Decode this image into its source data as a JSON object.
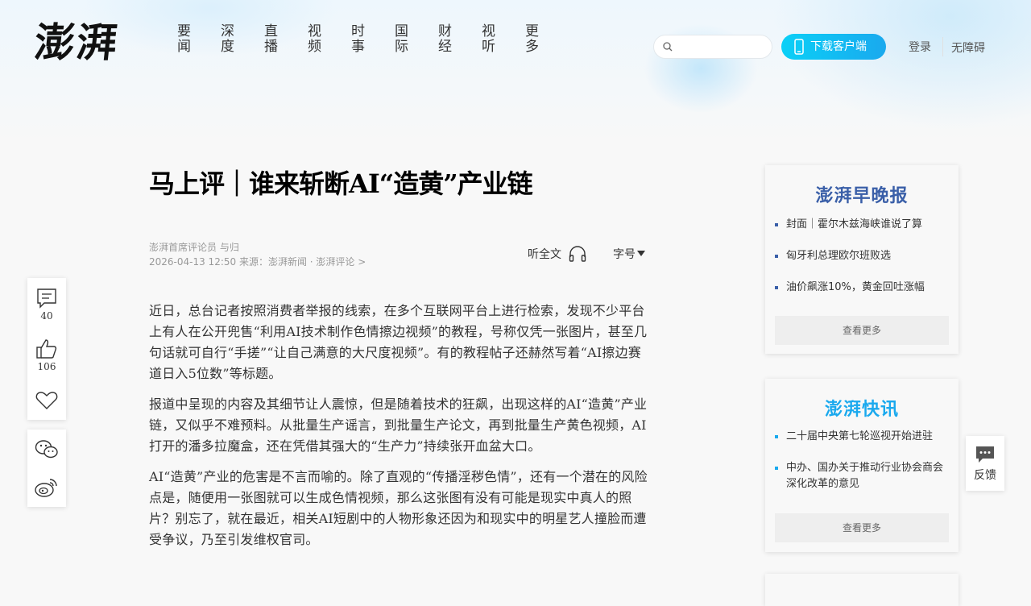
{
  "header": {
    "logo": "澎湃",
    "nav": [
      "要闻",
      "深度",
      "直播",
      "视频",
      "时事",
      "国际",
      "财经",
      "视听",
      "更多"
    ],
    "search_placeholder": "",
    "download_label": "下载客户端",
    "login_label": "登录",
    "accessibility_label": "无障碍"
  },
  "article": {
    "title": "马上评｜谁来斩断AI“造黄”产业链",
    "author": "澎湃首席评论员 与归",
    "meta": "2026-04-13 12:50  来源：澎湃新闻 · 澎湃评论 >",
    "listen_label": "听全文",
    "font_size_label": "字号",
    "paragraphs": [
      "近日，总台记者按照消费者举报的线索，在多个互联网平台上进行检索，发现不少平台上有人在公开兜售“利用AI技术制作色情擦边视频”的教程，号称仅凭一张图片，甚至几句话就可自行“手搓”“让自己满意的大尺度视频”。有的教程帖子还赫然写着“AI擦边赛道日入5位数”等标题。",
      "报道中呈现的内容及其细节让人震惊，但是随着技术的狂飙，出现这样的AI“造黄”产业链，又似乎不难预料。从批量生产谣言，到批量生产论文，再到批量生产黄色视频，AI打开的潘多拉魔盒，还在凭借其强大的“生产力”持续张开血盆大口。",
      "AI“造黄”产业的危害是不言而喻的。除了直观的“传播淫秽色情”，还有一个潜在的风险点是，随便用一张图就可以生成色情视频，那么这张图有没有可能是现实中真人的照片？别忘了，就在最近，相关AI短剧中的人物形象还因为和现实中的明星艺人撞脸而遭受争议，乃至引发维权官司。"
    ]
  },
  "toolbar": {
    "comment_count": "40",
    "like_count": "106"
  },
  "sidebar": {
    "evening_logo": "澎湃早晚报",
    "evening_items": [
      "封面｜霍尔木兹海峡谁说了算",
      "匈牙利总理欧尔班败选",
      "油价飙涨10%，黄金回吐涨幅"
    ],
    "evening_more": "查看更多",
    "express_logo": "澎湃快讯",
    "express_items": [
      "二十届中央第七轮巡视开始进驻",
      "中办、国办关于推动行业协会商会深化改革的意见"
    ],
    "express_more": "查看更多",
    "colors": {
      "evening_dot": "#3a5fa8",
      "express_dot": "#1aa9ee"
    }
  },
  "feedback_label": "反馈"
}
